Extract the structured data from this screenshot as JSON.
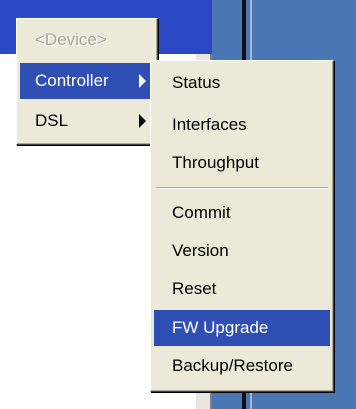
{
  "parent_menu": {
    "items": [
      {
        "label": "<Device>",
        "state": "disabled"
      },
      {
        "label": "Controller",
        "state": "highlighted",
        "has_submenu": true
      },
      {
        "label": "DSL",
        "state": "normal",
        "has_submenu": true
      }
    ]
  },
  "submenu": {
    "items": [
      {
        "label": "Status"
      },
      {
        "label": "Interfaces"
      },
      {
        "label": "Throughput"
      },
      {
        "label": "Commit"
      },
      {
        "label": "Version"
      },
      {
        "label": "Reset"
      },
      {
        "label": "FW Upgrade",
        "state": "highlighted"
      },
      {
        "label": "Backup/Restore"
      }
    ]
  },
  "colors": {
    "highlight": "#2f4fb4",
    "menu_bg": "#ece9d8",
    "titlebar": "#2b49c6"
  }
}
